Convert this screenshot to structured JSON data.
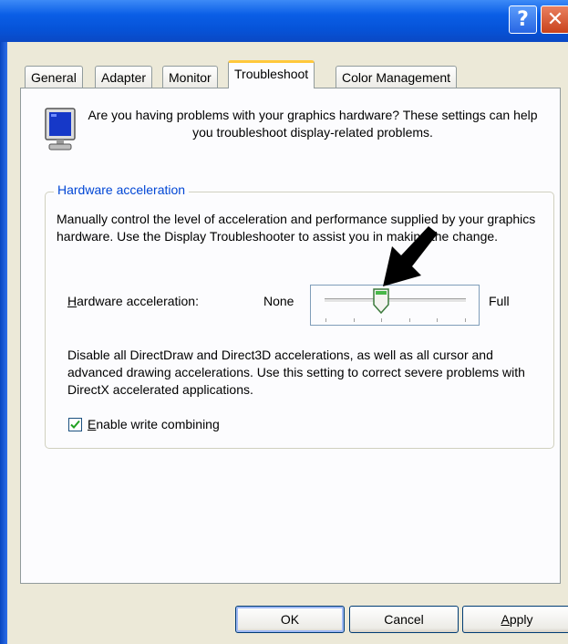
{
  "titlebar": {
    "help_label": "?",
    "close_label": "✕"
  },
  "tabs": [
    {
      "label": "General",
      "active": false
    },
    {
      "label": "Adapter",
      "active": false
    },
    {
      "label": "Monitor",
      "active": false
    },
    {
      "label": "Troubleshoot",
      "active": true
    },
    {
      "label": "Color Management",
      "active": false
    }
  ],
  "intro": {
    "icon": "monitor-icon",
    "text": "Are you having problems with your graphics hardware? These settings can help you troubleshoot display-related problems."
  },
  "hardware_acceleration": {
    "group_title": "Hardware acceleration",
    "description": "Manually control the level of acceleration and performance supplied by your graphics hardware. Use the Display Troubleshooter to assist you in making the change.",
    "slider_label_mnemonic": "H",
    "slider_label_rest": "ardware acceleration:",
    "min_label": "None",
    "max_label": "Full",
    "slider_positions": 6,
    "slider_value_index": 2,
    "level_description": "Disable all DirectDraw and Direct3D accelerations, as well as all cursor and advanced drawing accelerations. Use this setting to correct severe problems with DirectX accelerated applications.",
    "write_combining": {
      "mnemonic": "E",
      "rest": "nable write combining",
      "checked": true
    }
  },
  "annotation_arrow": "pointer-arrow-icon",
  "buttons": {
    "ok": "OK",
    "cancel": "Cancel",
    "apply_mnemonic": "A",
    "apply_rest": "pply"
  },
  "colors": {
    "accent": "#0046d5",
    "titlebar": "#0a5ee6",
    "dialog_bg": "#ece9d8",
    "tab_highlight": "#ffc83c"
  }
}
